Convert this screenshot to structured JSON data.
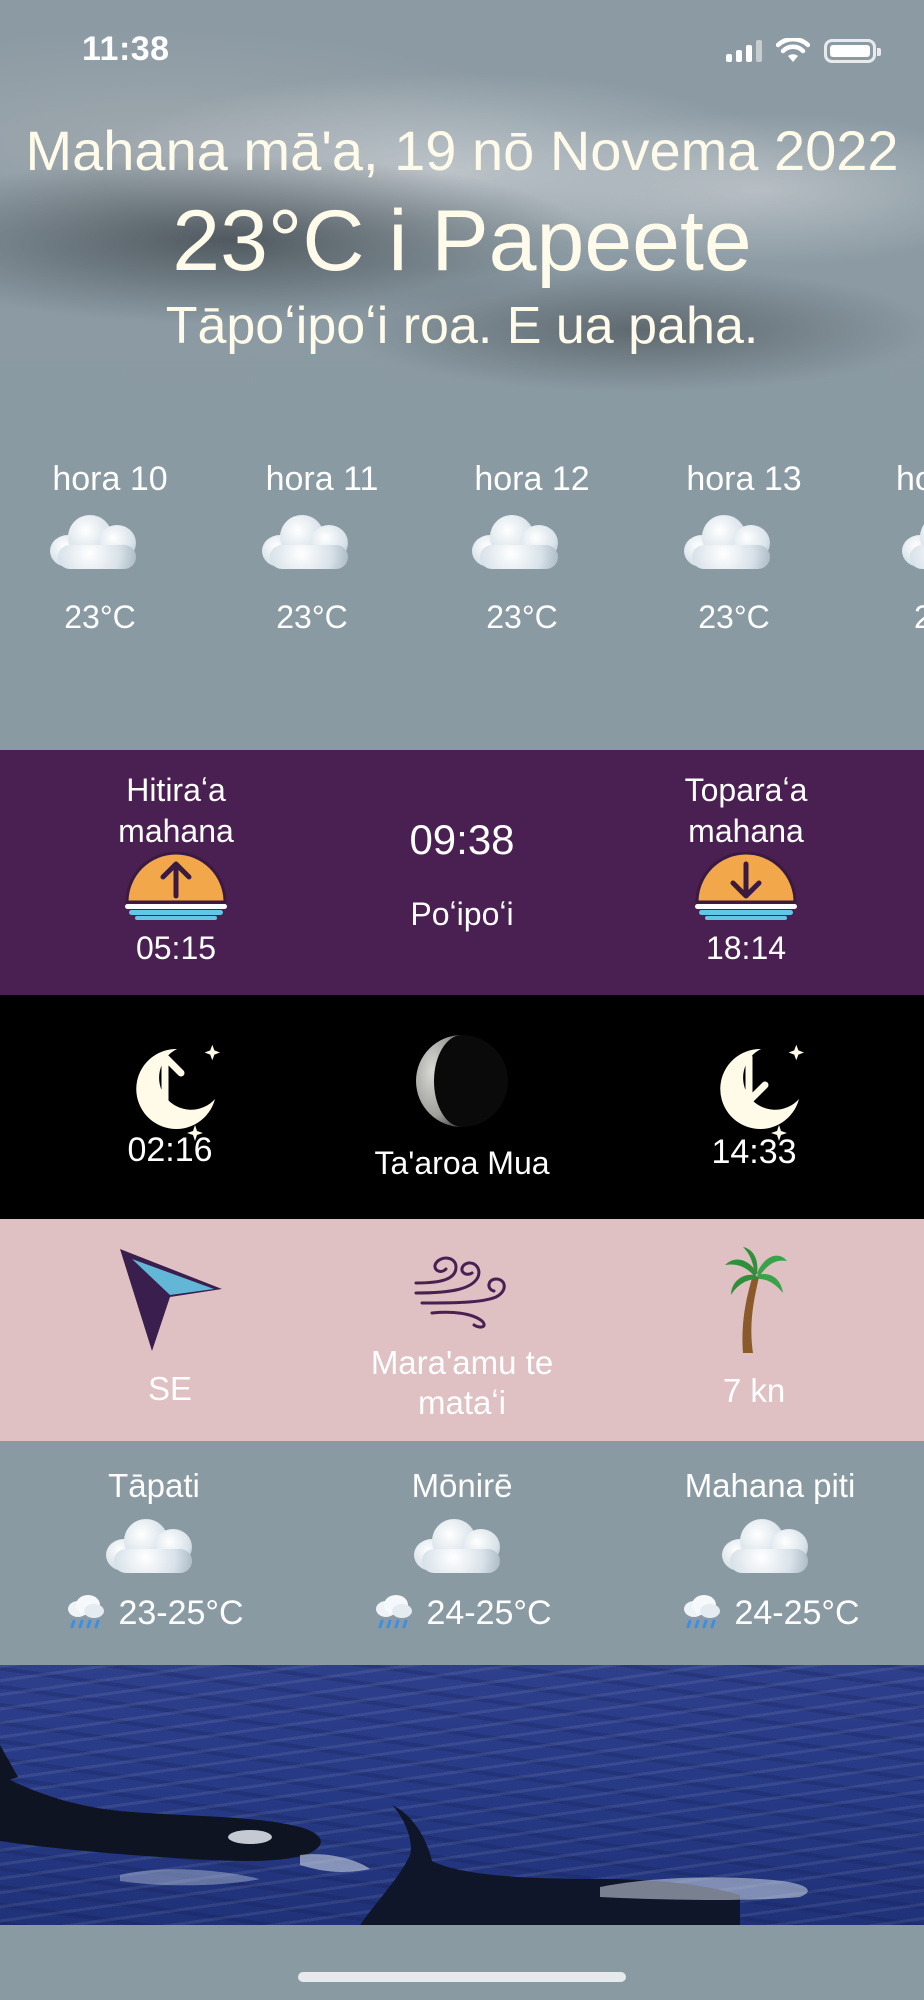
{
  "status_bar": {
    "time": "11:38",
    "icons": [
      "cellular-signal-icon",
      "wifi-icon",
      "battery-icon"
    ]
  },
  "header": {
    "date": "Mahana mā'a, 19 nō Novema 2022",
    "temp_location": "23°C i Papeete",
    "description": "Tāpoʻipoʻi roa. E ua paha."
  },
  "hourly": [
    {
      "label": "hora 10",
      "icon": "cloud-icon",
      "temp": "23°C"
    },
    {
      "label": "hora 11",
      "icon": "cloud-icon",
      "temp": "23°C"
    },
    {
      "label": "hora 12",
      "icon": "cloud-icon",
      "temp": "23°C"
    },
    {
      "label": "hora 13",
      "icon": "cloud-icon",
      "temp": "23°C"
    },
    {
      "label": "ho",
      "icon": "cloud-icon",
      "temp": "2"
    }
  ],
  "sun": {
    "sunrise_label": "Hitiraʻa mahana",
    "sunrise_label_line1": "Hitiraʻa",
    "sunrise_label_line2": "mahana",
    "sunrise_time": "05:15",
    "day_length": "09:38",
    "day_state": "Poʻipoʻi",
    "sunset_label_line1": "Toparaʻa",
    "sunset_label_line2": "mahana",
    "sunset_time": "18:14"
  },
  "moon": {
    "moonrise_time": "02:16",
    "phase_name": "Ta'aroa Mua",
    "moonset_time": "14:33"
  },
  "wind": {
    "direction": "SE",
    "name_line1": "Mara'amu te",
    "name_line2": "mataʻi",
    "speed": "7 kn"
  },
  "daily": [
    {
      "day": "Tāpati",
      "icon": "cloud-icon",
      "rain_icon": "rain-cloud-icon",
      "range": "23-25°C"
    },
    {
      "day": "Mōnirē",
      "icon": "cloud-icon",
      "rain_icon": "rain-cloud-icon",
      "range": "24-25°C"
    },
    {
      "day": "Mahana piti",
      "icon": "cloud-icon",
      "rain_icon": "rain-cloud-icon",
      "range": "24-25°C"
    }
  ],
  "colors": {
    "sun_panel": "#4a1f52",
    "moon_panel": "#000000",
    "wind_panel": "#dfc1c4",
    "forecast_bg": "#8a9aa3",
    "sun_orange": "#f2a84a",
    "wave_blue": "#62c6e6"
  }
}
